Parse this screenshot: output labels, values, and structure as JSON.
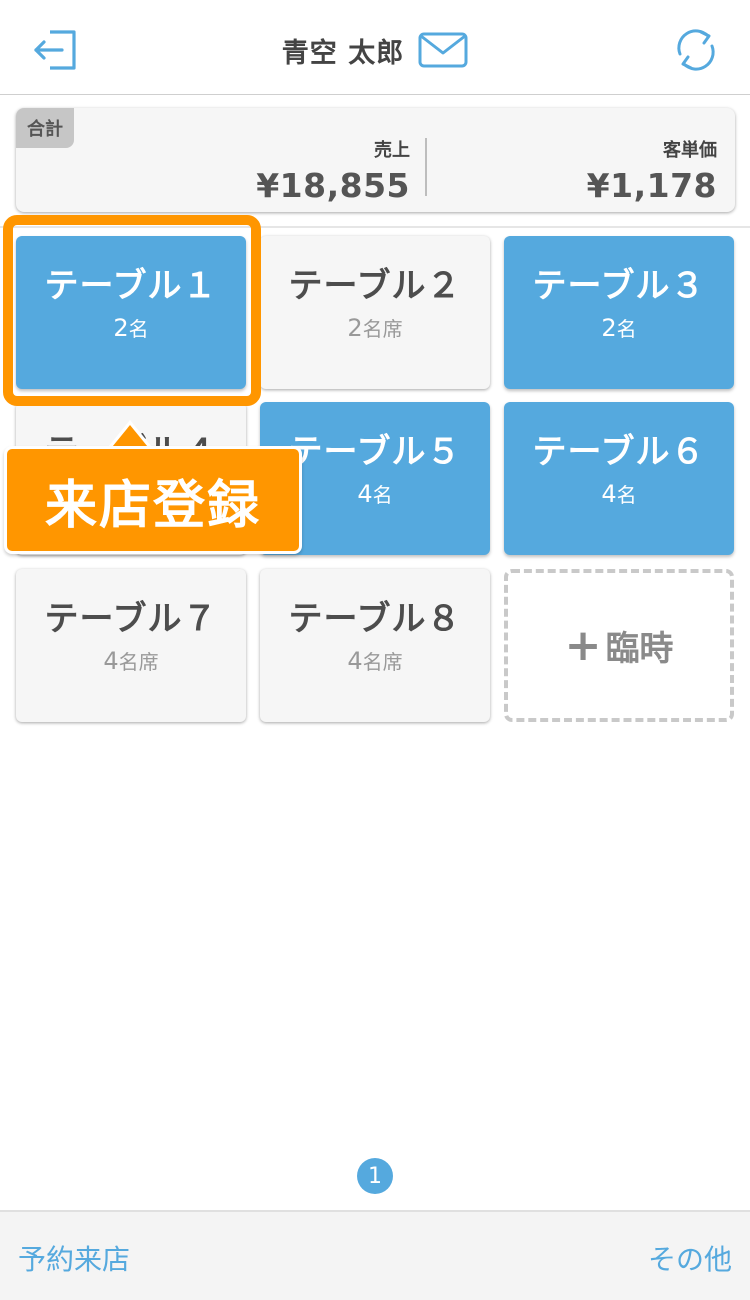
{
  "header": {
    "user_name": "青空 太郎",
    "logout_icon": "logout-icon",
    "mail_icon": "mail-icon",
    "refresh_icon": "refresh-icon"
  },
  "summary": {
    "tag": "合計",
    "sales_label": "売上",
    "sales_value": "¥18,855",
    "avg_label": "客単価",
    "avg_value": "¥1,178"
  },
  "tables": [
    {
      "name": "テーブル１",
      "count": "2",
      "unit": "名",
      "status": "occupied"
    },
    {
      "name": "テーブル２",
      "count": "2",
      "unit": "名席",
      "status": "vacant"
    },
    {
      "name": "テーブル３",
      "count": "2",
      "unit": "名",
      "status": "occupied"
    },
    {
      "name": "テーブル４",
      "count": "",
      "unit": "",
      "status": "vacant"
    },
    {
      "name": "テーブル５",
      "count": "4",
      "unit": "名",
      "status": "occupied"
    },
    {
      "name": "テーブル６",
      "count": "4",
      "unit": "名",
      "status": "occupied"
    },
    {
      "name": "テーブル７",
      "count": "4",
      "unit": "名席",
      "status": "vacant"
    },
    {
      "name": "テーブル８",
      "count": "4",
      "unit": "名席",
      "status": "vacant"
    }
  ],
  "temporary": {
    "plus": "+",
    "label": "臨時"
  },
  "callout": {
    "text": "来店登録"
  },
  "pagination": {
    "current": "1"
  },
  "footer": {
    "left": "予約来店",
    "right": "その他"
  },
  "colors": {
    "accent": "#55a9de",
    "highlight": "#ff9600",
    "vacant_bg": "#f6f6f6"
  }
}
